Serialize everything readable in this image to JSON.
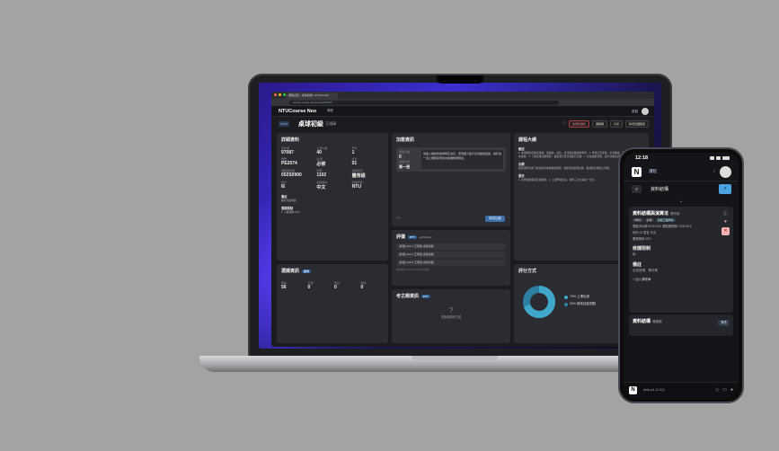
{
  "browser": {
    "tab_title": "課程資訊 - 桌球初級 | NTUCourse",
    "url": "course.myntu.me/courses/97087"
  },
  "app": {
    "logo": "NTUCourse Neo",
    "nav_item": "課程",
    "header_link": "首頁"
  },
  "course": {
    "code": "97087",
    "title": "桌球初級",
    "teacher": "王翊璋",
    "actions": [
      "加選到課表",
      "課程網",
      "分享",
      "新增至課程單"
    ]
  },
  "detail_card": {
    "title": "詳細資料",
    "fields": [
      {
        "label": "流水號",
        "value": "97087"
      },
      {
        "label": "上課人數",
        "value": "40"
      },
      {
        "label": "學分",
        "value": "1"
      },
      {
        "label": "課號",
        "value": "PE2074"
      },
      {
        "label": "必/選",
        "value": "必修"
      },
      {
        "label": "班次",
        "value": "01"
      },
      {
        "label": "課程識別碼",
        "value": "002S0900"
      },
      {
        "label": "學期",
        "value": "1102"
      },
      {
        "label": "開課系所",
        "value": "體育組"
      },
      {
        "label": "節次",
        "value": "I6"
      },
      {
        "label": "授課語言",
        "value": "中文"
      },
      {
        "label": "開課學校",
        "value": "NTU"
      }
    ],
    "notes_label": "備註",
    "notes_value": "體育室桌球館",
    "limit_label": "選課限制",
    "limit_value": "1. 人數限制 40人"
  },
  "enroll_card": {
    "title": "選課資訊",
    "badge": "即時",
    "stats": [
      {
        "label": "剩餘",
        "value": "56"
      },
      {
        "label": "已選",
        "value": "0"
      },
      {
        "label": "登記",
        "value": "0"
      },
      {
        "label": "剩餘",
        "value": "0"
      }
    ]
  },
  "signup_card": {
    "title": "加簽資訊",
    "note_head": "加簽人數",
    "note_value": "0",
    "note_text": "加簽人數將依教師規定決定，若選課人數不足會開放加簽，請於第一週上課時至現場向授課教師登記。",
    "method_label": "加簽方式",
    "method_value": "第一週",
    "button": "填寫加簽"
  },
  "review_card": {
    "title": "評價",
    "badge": "PTT",
    "source": "ptt/Salary",
    "items": [
      "[評價] 110-1 王翊璋 桌球初級",
      "[評價] 110-2 王翊璋 桌球初級",
      "[評價] 109-2 王翊璋 桌球初級"
    ],
    "footer": "資料來源: PTT NTUcourse 看板"
  },
  "exam_card": {
    "title": "考古題資訊",
    "badge": "PTT",
    "empty": "查無相關考古題"
  },
  "syllabus_card": {
    "title": "課程大綱",
    "overview_head": "概述",
    "overview_text": "1. 本課程為初級桌球課，從握拍、站位、步法等基礎開始教學。2. 學習正手攻球、反手推擋、發球及接發球等基本技術。3. 了解桌球比賽規則，並能進行單打與雙打比賽。4. 培養運動習慣，提升身體協調性與反應能力。",
    "goal_head": "目標",
    "goal_text": "使修課學生能了解桌球基本技術與規則，並能參與基礎比賽，養成終身運動之習慣。",
    "req_head": "要求",
    "req_text": "1. 穿著運動服裝及運動鞋。2. 上課準時出席，遲到三次以缺席一次計。",
    "grading_title": "評分方式",
    "grading_items": [
      {
        "label": "70% 上課出席",
        "color": "#3fa7c9"
      },
      {
        "label": "30% 期末技能測驗",
        "color": "#2e7fa3"
      }
    ]
  },
  "phone": {
    "time": "12:18",
    "nav": "課程",
    "query": "資料結構",
    "result_title": "資料結構與演算法",
    "result_teacher": "蔡欣穆",
    "result_tags": [
      "3學分",
      "必修",
      "資訊工程學系"
    ],
    "result_meta1": "課程流水號 90210702",
    "result_meta1b": "課程識別碼 CSIE1212",
    "result_meta2": "系所 02 語言 中文",
    "result_meta3": "開課學校 NTU",
    "limit_title": "修課限制",
    "limit_value": "無",
    "notes_title": "備註",
    "notes_value": "全英授課，需作業",
    "add_label": "加入課程單",
    "second_title": "資料結構",
    "second_teacher": "陳建錦",
    "second_btn": "課表",
    "bottom_ver": "beta (v1.12.12)"
  },
  "colors": {
    "accent": "#4aa3e0",
    "screen_gradient_start": "#2a1a8c",
    "danger": "#f3b0b0"
  }
}
